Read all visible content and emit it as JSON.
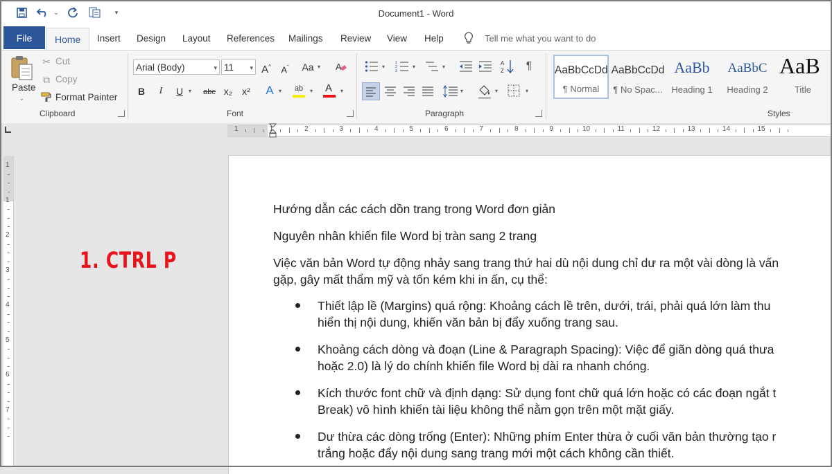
{
  "window": {
    "title": "Document1  -  Word"
  },
  "tabs": {
    "file": "File",
    "items": [
      "Home",
      "Insert",
      "Design",
      "Layout",
      "References",
      "Mailings",
      "Review",
      "View",
      "Help"
    ],
    "tell_me": "Tell me what you want to do"
  },
  "clipboard": {
    "paste": "Paste",
    "cut": "Cut",
    "copy": "Copy",
    "format_painter": "Format Painter",
    "label": "Clipboard"
  },
  "font": {
    "name": "Arial (Body)",
    "size": "11",
    "grow": "A",
    "shrink": "A",
    "case": "Aa",
    "bold": "B",
    "italic": "I",
    "underline": "U",
    "strike": "abc",
    "sub": "x₂",
    "sup": "x²",
    "effects": "A",
    "highlight": "ab",
    "color": "A",
    "label": "Font"
  },
  "paragraph": {
    "label": "Paragraph",
    "show_marks": "¶"
  },
  "styles": {
    "label": "Styles",
    "items": [
      {
        "sample": "AaBbCcDd",
        "name": "¶ Normal"
      },
      {
        "sample": "AaBbCcDd",
        "name": "¶ No Spac..."
      },
      {
        "sample": "AaBb",
        "name": "Heading 1"
      },
      {
        "sample": "AaBbC",
        "name": "Heading 2"
      },
      {
        "sample": "AaB",
        "name": "Title"
      }
    ]
  },
  "ruler": {
    "numbers": [
      "1",
      "1",
      "2",
      "3",
      "4",
      "5",
      "6",
      "7",
      "8",
      "9",
      "10",
      "11",
      "12",
      "13",
      "14",
      "15"
    ]
  },
  "vruler": {
    "numbers": [
      "1",
      "1",
      "2",
      "3",
      "4",
      "5",
      "6",
      "7"
    ]
  },
  "document": {
    "heading1": "Hướng dẫn các cách dồn trang trong Word đơn giản",
    "heading2": "Nguyên nhân khiến file Word bị tràn sang 2 trang",
    "intro_line1": "Việc văn bản Word tự động nhảy sang trang thứ hai dù nội dung chỉ dư ra một vài dòng là vấn",
    "intro_line2": "gặp, gây mất thẩm mỹ và tốn kém khi in ấn, cụ thể:",
    "bullets": [
      {
        "line1": "Thiết lập lề (Margins) quá rộng: Khoảng cách lề trên, dưới, trái, phải quá lớn làm thu",
        "line2": "hiển thị nội dung, khiến văn bản bị đẩy xuống trang sau."
      },
      {
        "line1": "Khoảng cách dòng và đoạn (Line & Paragraph Spacing): Việc để giãn dòng quá thưa",
        "line2": "hoặc 2.0) là lý do chính khiến file Word bị dài ra nhanh chóng."
      },
      {
        "line1": "Kích thước font chữ và định dạng: Sử dụng font chữ quá lớn hoặc có các đoạn ngắt t",
        "line2": "Break) vô hình khiến tài liệu không thể nằm gọn trên một mặt giấy."
      },
      {
        "line1": "Dư thừa các dòng trống (Enter): Những phím Enter thừa ở cuối văn bản thường tạo r",
        "line2": "trắng hoặc đẩy nội dung sang trang mới một cách không cần thiết."
      }
    ]
  },
  "overlay": {
    "label": "1.  CTRL P"
  },
  "colors": {
    "accent": "#2b579a",
    "overlay": "#e8131b"
  }
}
